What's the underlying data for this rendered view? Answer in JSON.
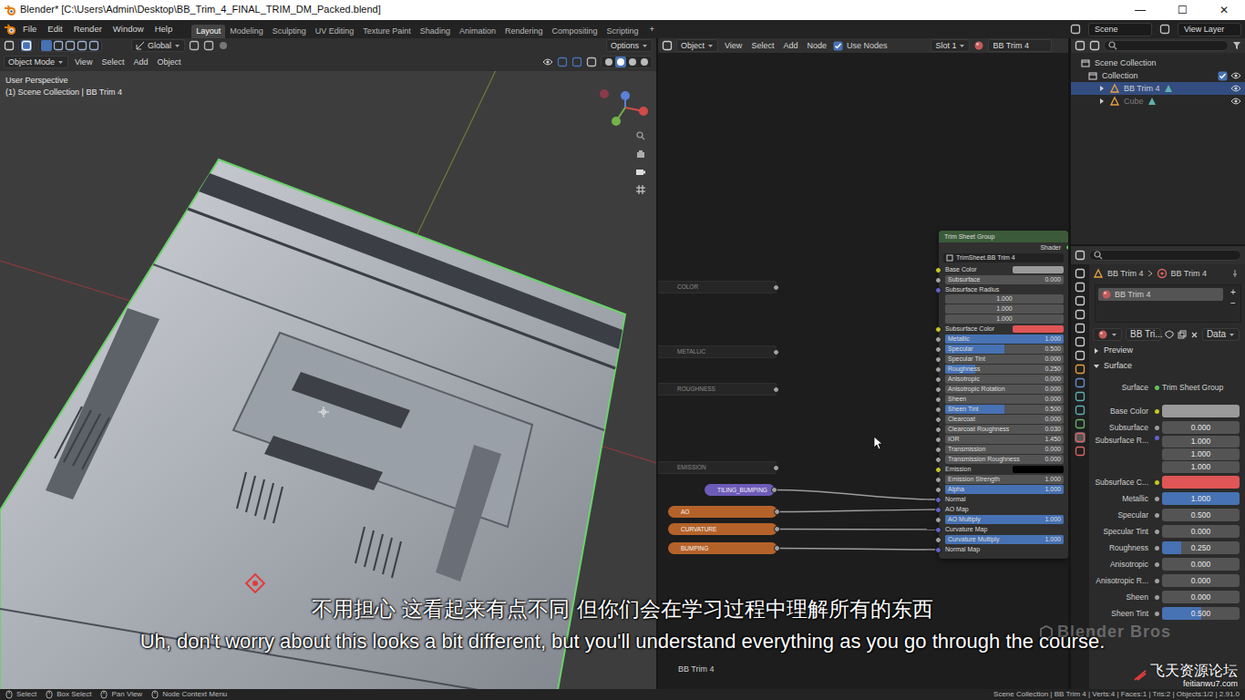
{
  "window": {
    "title": "Blender* [C:\\Users\\Admin\\Desktop\\BB_Trim_4_FINAL_TRIM_DM_Packed.blend]",
    "controls": [
      "—",
      "☐",
      "✕"
    ]
  },
  "menu": [
    "File",
    "Edit",
    "Render",
    "Window",
    "Help"
  ],
  "workspaces": [
    {
      "label": "Layout",
      "selected": true
    },
    {
      "label": "Modeling",
      "selected": false
    },
    {
      "label": "Sculpting",
      "selected": false
    },
    {
      "label": "UV Editing",
      "selected": false
    },
    {
      "label": "Texture Paint",
      "selected": false
    },
    {
      "label": "Shading",
      "selected": false
    },
    {
      "label": "Animation",
      "selected": false
    },
    {
      "label": "Rendering",
      "selected": false
    },
    {
      "label": "Compositing",
      "selected": false
    },
    {
      "label": "Scripting",
      "selected": false
    }
  ],
  "workspace_add": "+",
  "scene": "Scene",
  "view_layer": "View Layer",
  "viewport": {
    "orientation": "Global",
    "options": "Options",
    "mode": "Object Mode",
    "menus": [
      "View",
      "Select",
      "Add",
      "Object"
    ],
    "overlay": [
      "User Perspective",
      "(1) Scene Collection | BB Trim 4"
    ]
  },
  "node_editor": {
    "type": "Object",
    "menus": [
      "View",
      "Select",
      "Add",
      "Node"
    ],
    "use_nodes": {
      "label": "Use Nodes",
      "checked": true
    },
    "slot": "Slot 1",
    "material": "BB Trim 4",
    "footer": "BB Trim 4",
    "frames": [
      "COLOR",
      "METALLIC",
      "ROUGHNESS",
      "EMISSION"
    ],
    "inputs": [
      {
        "label": "TILING_BUMPING",
        "color": "#6d5bb8",
        "target": "Normal"
      },
      {
        "label": "AO",
        "color": "#b5622a",
        "target": "AO Map"
      },
      {
        "label": "CURVATURE",
        "color": "#b5622a",
        "target": "Curvature Map"
      },
      {
        "label": "BUMPING",
        "color": "#b5622a",
        "target": "Normal Map"
      }
    ],
    "group": {
      "title": "Trim Sheet Group",
      "output": "Shader",
      "datablock": "TrimSheet.BB Trim 4",
      "rows": [
        {
          "label": "Base Color",
          "kind": "color",
          "color": "#9a9a9a"
        },
        {
          "label": "Subsurface",
          "kind": "number",
          "value": "0.000"
        },
        {
          "label": "Subsurface Radius",
          "kind": "triple",
          "values": [
            "1.000",
            "1.000",
            "1.000"
          ]
        },
        {
          "label": "Subsurface Color",
          "kind": "color",
          "color": "#e05555"
        },
        {
          "label": "Metallic",
          "kind": "bar",
          "value": "1.000",
          "level": 1
        },
        {
          "label": "Specular",
          "kind": "bar",
          "value": "0.500",
          "level": 0.5
        },
        {
          "label": "Specular Tint",
          "kind": "number",
          "value": "0.000"
        },
        {
          "label": "Roughness",
          "kind": "bar",
          "value": "0.250",
          "level": 0.25
        },
        {
          "label": "Anisotropic",
          "kind": "number",
          "value": "0.000"
        },
        {
          "label": "Anisotropic Rotation",
          "kind": "number",
          "value": "0.000"
        },
        {
          "label": "Sheen",
          "kind": "number",
          "value": "0.000"
        },
        {
          "label": "Sheen Tint",
          "kind": "bar",
          "value": "0.500",
          "level": 0.5
        },
        {
          "label": "Clearcoat",
          "kind": "number",
          "value": "0.000"
        },
        {
          "label": "Clearcoat Roughness",
          "kind": "number",
          "value": "0.030"
        },
        {
          "label": "IOR",
          "kind": "number",
          "value": "1.450"
        },
        {
          "label": "Transmission",
          "kind": "number",
          "value": "0.000"
        },
        {
          "label": "Transmission Roughness",
          "kind": "number",
          "value": "0.000"
        },
        {
          "label": "Emission",
          "kind": "color",
          "color": "#000000"
        },
        {
          "label": "Emission Strength",
          "kind": "number",
          "value": "1.000"
        },
        {
          "label": "Alpha",
          "kind": "bar",
          "value": "1.000",
          "level": 1
        },
        {
          "label": "Normal",
          "kind": "socket"
        },
        {
          "label": "AO Map",
          "kind": "socket"
        },
        {
          "label": "AO Multiply",
          "kind": "bar",
          "value": "1.000",
          "level": 1
        },
        {
          "label": "Curvature Map",
          "kind": "socket"
        },
        {
          "label": "Curvature Multiply",
          "kind": "bar",
          "value": "1.000",
          "level": 1
        },
        {
          "label": "Normal Map",
          "kind": "socket"
        }
      ]
    }
  },
  "outliner": {
    "rows": [
      {
        "label": "Scene Collection",
        "kind": "scene",
        "selected": false,
        "dimmed": false
      },
      {
        "label": "Collection",
        "kind": "collection",
        "selected": false,
        "dimmed": false,
        "checked": true
      },
      {
        "label": "BB Trim 4",
        "kind": "object",
        "selected": true,
        "dimmed": false
      },
      {
        "label": "Cube",
        "kind": "object",
        "selected": false,
        "dimmed": true
      }
    ]
  },
  "properties": {
    "breadcrumb": [
      "BB Trim 4",
      "BB Trim 4"
    ],
    "slots": [
      {
        "label": "BB Trim 4",
        "selected": true
      }
    ],
    "slot_buttons": [
      "+",
      "−"
    ],
    "material_field": "BB Tri...",
    "link": "Data",
    "panels": [
      {
        "label": "Preview",
        "expanded": false
      },
      {
        "label": "Surface",
        "expanded": true
      }
    ],
    "rows": [
      {
        "label": "Surface",
        "kind": "link",
        "value": "Trim Sheet Group"
      },
      {
        "label": "Base Color",
        "kind": "color",
        "color": "#9a9a9a"
      },
      {
        "label": "Subsurface",
        "kind": "number",
        "value": "0.000"
      },
      {
        "label": "Subsurface R...",
        "kind": "triple",
        "values": [
          "1.000",
          "1.000",
          "1.000"
        ]
      },
      {
        "label": "Subsurface C...",
        "kind": "color",
        "color": "#e05555"
      },
      {
        "label": "Metallic",
        "kind": "bar",
        "value": "1.000",
        "level": 1
      },
      {
        "label": "Specular",
        "kind": "number",
        "value": "0.500"
      },
      {
        "label": "Specular Tint",
        "kind": "number",
        "value": "0.000"
      },
      {
        "label": "Roughness",
        "kind": "bar",
        "value": "0.250",
        "level": 0.25
      },
      {
        "label": "Anisotropic",
        "kind": "number",
        "value": "0.000"
      },
      {
        "label": "Anisotropic R...",
        "kind": "number",
        "value": "0.000"
      },
      {
        "label": "Sheen",
        "kind": "number",
        "value": "0.000"
      },
      {
        "label": "Sheen Tint",
        "kind": "bar",
        "value": "0.500",
        "level": 0.5
      }
    ]
  },
  "status_bar": {
    "items": [
      "Select",
      "Box Select",
      "Pan View",
      "Node Context Menu"
    ],
    "stats": "Scene Collection | BB Trim 4 | Verts:4 | Faces:1 | Tris:2 | Objects:1/2 | 2.91.0"
  },
  "subtitles": {
    "zh": "不用担心 这看起来有点不同 但你们会在学习过程中理解所有的东西",
    "en": "Uh, don't worry about this looks a bit different, but you'll understand everything as you go through the course."
  },
  "logo": "Blender Bros",
  "watermark": {
    "site": "飞天资源论坛",
    "url": "feitianwu7.com"
  }
}
